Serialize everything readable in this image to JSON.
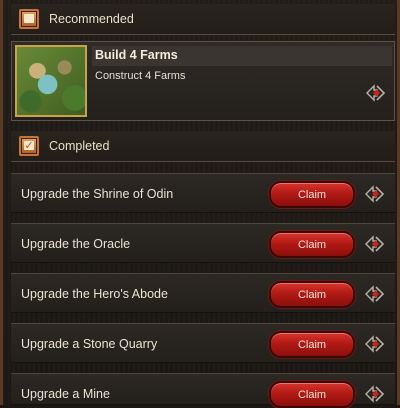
{
  "recommended": {
    "header_label": "Recommended",
    "icon": "scroll-icon",
    "quest": {
      "title": "Build 4 Farms",
      "description": "Construct 4 Farms",
      "thumbnail": "farm-thumbnail"
    }
  },
  "completed": {
    "header_label": "Completed",
    "icon": "checkmark-scroll-icon",
    "items": [
      {
        "label": "Upgrade the Shrine of Odin",
        "button": "Claim"
      },
      {
        "label": "Upgrade the Oracle",
        "button": "Claim"
      },
      {
        "label": "Upgrade the Hero's Abode",
        "button": "Claim"
      },
      {
        "label": "Upgrade a Stone Quarry",
        "button": "Claim"
      },
      {
        "label": "Upgrade a Mine",
        "button": "Claim"
      }
    ]
  },
  "colors": {
    "claim_red": "#b21a15",
    "header_orange": "#c4743a",
    "thumb_border": "#c9a24a"
  }
}
